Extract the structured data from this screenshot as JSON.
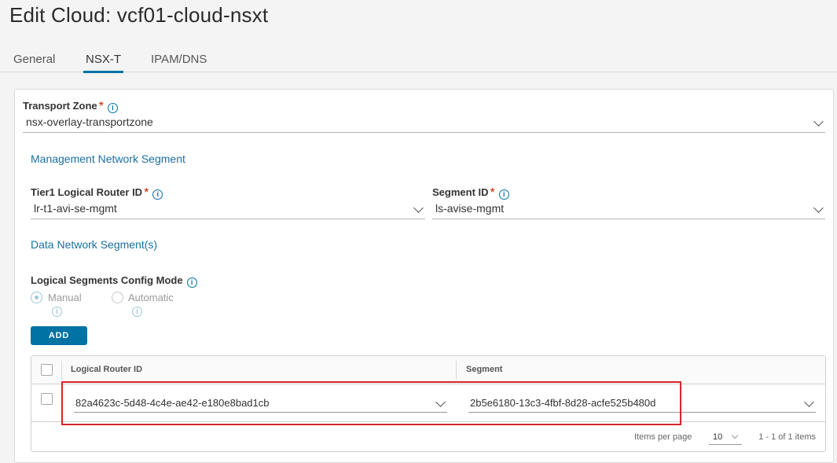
{
  "page": {
    "title": "Edit Cloud: vcf01-cloud-nsxt"
  },
  "tabs": [
    {
      "label": "General",
      "active": false
    },
    {
      "label": "NSX-T",
      "active": true
    },
    {
      "label": "IPAM/DNS",
      "active": false
    }
  ],
  "transport_zone": {
    "label": "Transport Zone",
    "value": "nsx-overlay-transportzone"
  },
  "management": {
    "heading": "Management Network Segment",
    "tier1_label": "Tier1 Logical Router ID",
    "tier1_value": "lr-t1-avi-se-mgmt",
    "segment_label": "Segment ID",
    "segment_value": "ls-avise-mgmt"
  },
  "data_network": {
    "heading": "Data Network Segment(s)",
    "mode_label": "Logical Segments Config Mode",
    "options": [
      {
        "label": "Manual",
        "checked": true
      },
      {
        "label": "Automatic",
        "checked": false
      }
    ],
    "add_label": "ADD",
    "grid": {
      "columns": [
        "Logical Router ID",
        "Segment"
      ],
      "rows": [
        {
          "router_id": "82a4623c-5d48-4c4e-ae42-e180e8bad1cb",
          "segment": "2b5e6180-13c3-4fbf-8d28-acfe525b480d"
        }
      ],
      "footer": {
        "items_per_page_label": "Items per page",
        "items_per_page_value": "10",
        "range": "1 - 1 of 1 items"
      }
    }
  },
  "icons": {
    "required_mark": "*",
    "info_glyph": "i"
  },
  "colors": {
    "accent": "#0072a3",
    "required": "#c92100",
    "highlight": "#d9242b"
  }
}
